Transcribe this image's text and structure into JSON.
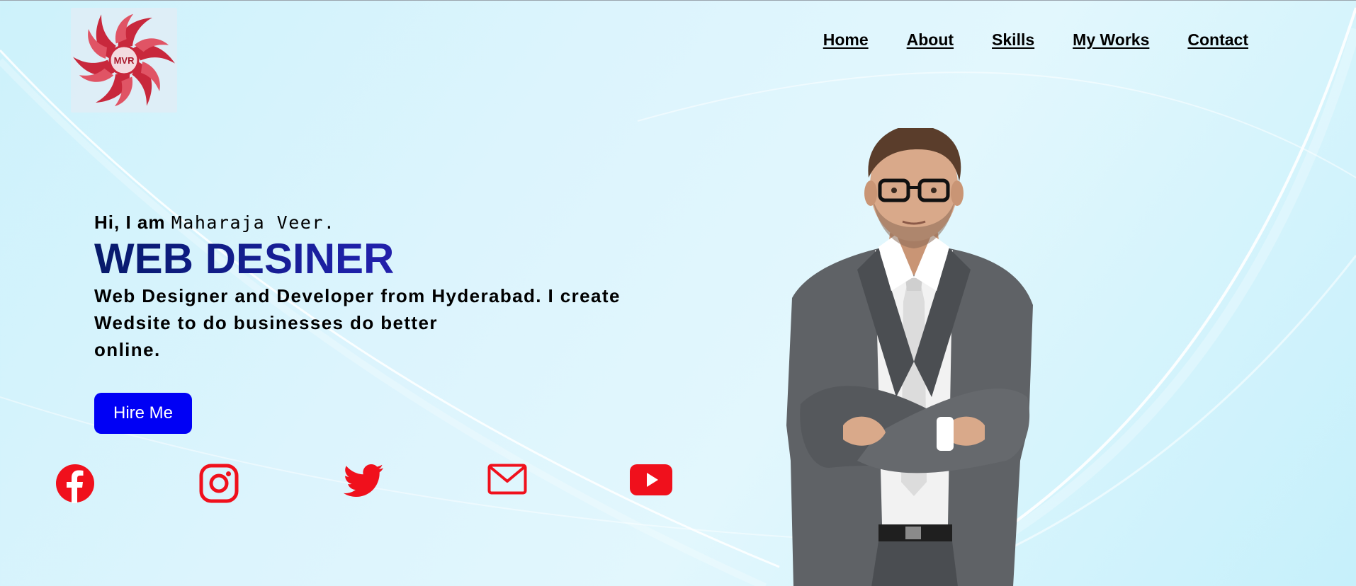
{
  "logo": {
    "text": "MVR",
    "color": "#c8283c"
  },
  "nav": {
    "items": [
      {
        "label": "Home"
      },
      {
        "label": "About"
      },
      {
        "label": "Skills"
      },
      {
        "label": "My Works"
      },
      {
        "label": "Contact"
      }
    ]
  },
  "hero": {
    "greeting_prefix": "Hi, I am",
    "name": "Maharaja Veer.",
    "headline": "WEB DESINER",
    "description_lines": [
      "Web Designer and Developer from Hyderabad. I create",
      "Wedsite to do businesses do better",
      "online."
    ],
    "hire_label": "Hire Me",
    "button_color": "#0000f5"
  },
  "social": {
    "icon_color": "#f0101c",
    "icons": [
      "facebook-icon",
      "instagram-icon",
      "twitter-icon",
      "mail-icon",
      "youtube-icon"
    ]
  },
  "portrait": {
    "description_icon": "man-in-suit-portrait"
  }
}
